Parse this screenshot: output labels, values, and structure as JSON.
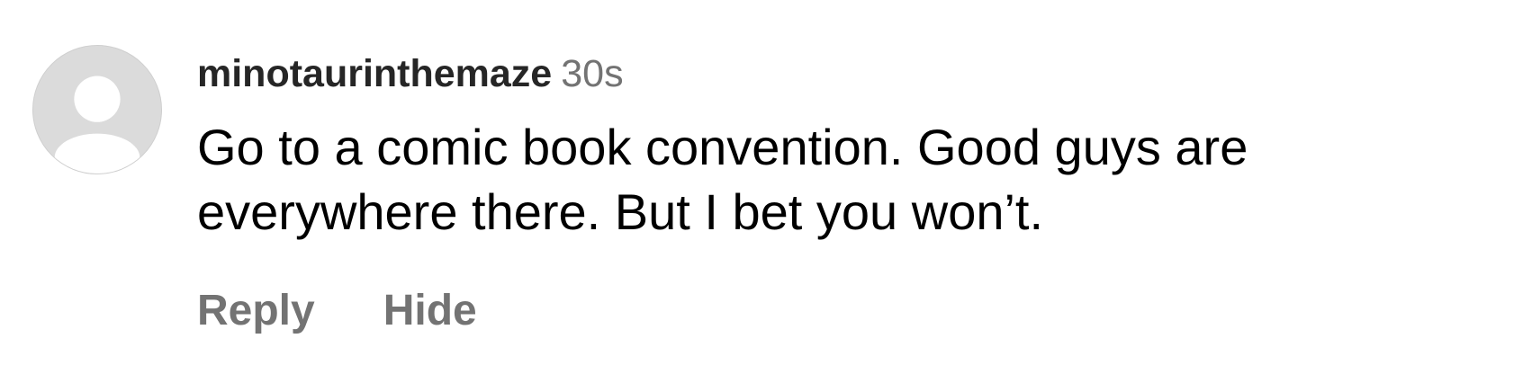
{
  "comment": {
    "username": "minotaurinthemaze",
    "timestamp": "30s",
    "text": "Go to a comic book convention. Good guys are everywhere there. But I bet you won’t.",
    "avatar_icon": "default-user-avatar-icon",
    "actions": {
      "reply_label": "Reply",
      "hide_label": "Hide"
    }
  },
  "colors": {
    "username": "#262626",
    "secondary_text": "#737373",
    "body_text": "#000000",
    "avatar_background": "#dbdbdb",
    "avatar_silhouette": "#ffffff"
  }
}
